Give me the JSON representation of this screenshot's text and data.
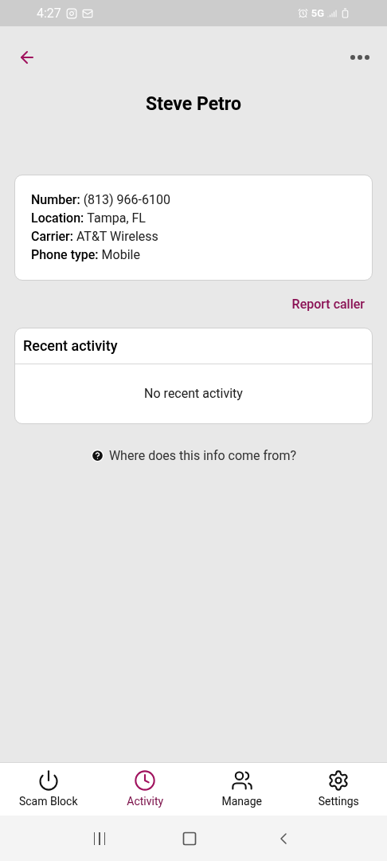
{
  "status_bar": {
    "time": "4:27",
    "network": "5G"
  },
  "header": {
    "title": "Steve Petro"
  },
  "details": [
    {
      "label": "Number:",
      "value": "(813) 966-6100"
    },
    {
      "label": "Location:",
      "value": "Tampa, FL"
    },
    {
      "label": "Carrier:",
      "value": "AT&T Wireless"
    },
    {
      "label": "Phone type:",
      "value": "Mobile"
    }
  ],
  "report_link": "Report caller",
  "recent_activity": {
    "title": "Recent activity",
    "empty_text": "No recent activity"
  },
  "info_link": "Where does this info come from?",
  "nav": [
    {
      "kind": "power",
      "label": "Scam Block",
      "selected": false
    },
    {
      "kind": "clock",
      "label": "Activity",
      "selected": true
    },
    {
      "kind": "people",
      "label": "Manage",
      "selected": false
    },
    {
      "kind": "gear",
      "label": "Settings",
      "selected": false
    }
  ]
}
